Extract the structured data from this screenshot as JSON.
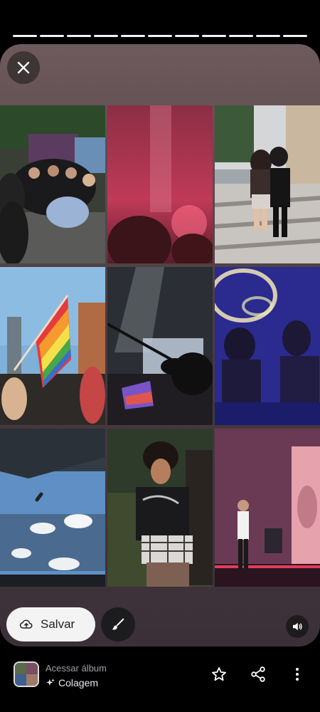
{
  "story": {
    "segments": 11,
    "active_segment": 11
  },
  "close": {
    "icon": "close-icon"
  },
  "collage": {
    "photos": [
      {
        "name": "photo-group-friends"
      },
      {
        "name": "photo-concert-red-lights"
      },
      {
        "name": "photo-couple-street"
      },
      {
        "name": "photo-rainbow-flag"
      },
      {
        "name": "photo-concert-flag-silhouette"
      },
      {
        "name": "photo-two-women-purple"
      },
      {
        "name": "photo-airplane-window"
      },
      {
        "name": "photo-woman-portrait"
      },
      {
        "name": "photo-singer-stage"
      }
    ]
  },
  "actions": {
    "save_label": "Salvar",
    "save_icon": "cloud-upload-icon",
    "edit_icon": "brush-icon",
    "sound_icon": "volume-icon"
  },
  "bottom_bar": {
    "access_album": "Acessar álbum",
    "album_type": "Colagem",
    "album_type_icon": "sparkle-icon",
    "star_icon": "star-icon",
    "share_icon": "share-icon",
    "more_icon": "more-vert-icon"
  },
  "colors": {
    "background": "#000000",
    "save_button": "#f3f3f3",
    "text_muted": "#9aa0a6",
    "text": "#e8eaed"
  }
}
